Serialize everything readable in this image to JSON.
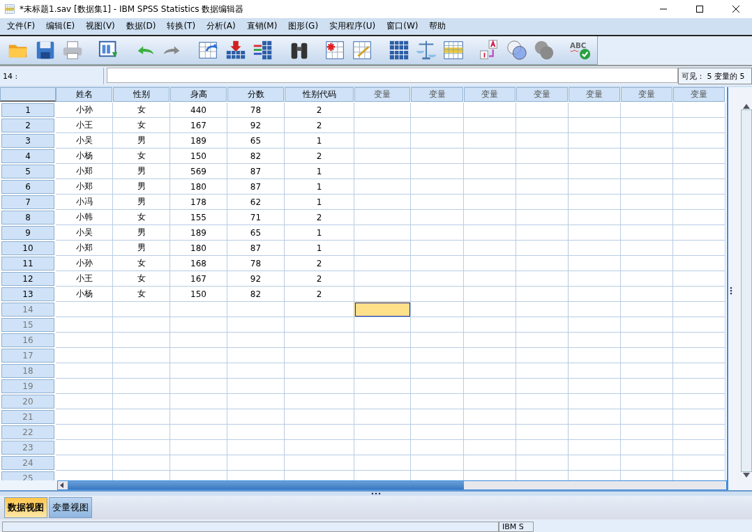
{
  "window": {
    "title": "*未标题1.sav [数据集1] - IBM SPSS Statistics 数据编辑器"
  },
  "menu": [
    "文件(F)",
    "编辑(E)",
    "视图(V)",
    "数据(D)",
    "转换(T)",
    "分析(A)",
    "直销(M)",
    "图形(G)",
    "实用程序(U)",
    "窗口(W)",
    "帮助"
  ],
  "toolbar": {
    "spell_check_text": "ABC"
  },
  "cell_editor": {
    "cell_ref": "14 :",
    "visible": "可见： 5 变量的 5"
  },
  "grid": {
    "columns": [
      {
        "label": "姓名",
        "kind": "defined",
        "selected": false
      },
      {
        "label": "性别",
        "kind": "defined",
        "selected": false
      },
      {
        "label": "身高",
        "kind": "defined",
        "selected": false
      },
      {
        "label": "分数",
        "kind": "defined",
        "selected": false
      },
      {
        "label": "性别代码",
        "kind": "defined",
        "selected": false
      },
      {
        "label": "变量",
        "kind": "empty",
        "selected": true
      },
      {
        "label": "变量",
        "kind": "empty",
        "selected": false
      },
      {
        "label": "变量",
        "kind": "empty",
        "selected": false
      },
      {
        "label": "变量",
        "kind": "empty",
        "selected": false
      },
      {
        "label": "变量",
        "kind": "empty",
        "selected": false
      },
      {
        "label": "变量",
        "kind": "empty",
        "selected": false
      },
      {
        "label": "变量",
        "kind": "empty",
        "selected": false
      }
    ],
    "rows": [
      {
        "number": "1",
        "empty": false,
        "selected": false,
        "cells": [
          "小孙",
          "女",
          "440",
          "78",
          "2"
        ]
      },
      {
        "number": "2",
        "empty": false,
        "selected": false,
        "cells": [
          "小王",
          "女",
          "167",
          "92",
          "2"
        ]
      },
      {
        "number": "3",
        "empty": false,
        "selected": false,
        "cells": [
          "小吴",
          "男",
          "189",
          "65",
          "1"
        ]
      },
      {
        "number": "4",
        "empty": false,
        "selected": false,
        "cells": [
          "小杨",
          "女",
          "150",
          "82",
          "2"
        ]
      },
      {
        "number": "5",
        "empty": false,
        "selected": false,
        "cells": [
          "小郑",
          "男",
          "569",
          "87",
          "1"
        ]
      },
      {
        "number": "6",
        "empty": false,
        "selected": false,
        "cells": [
          "小郑",
          "男",
          "180",
          "87",
          "1"
        ]
      },
      {
        "number": "7",
        "empty": false,
        "selected": false,
        "cells": [
          "小冯",
          "男",
          "178",
          "62",
          "1"
        ]
      },
      {
        "number": "8",
        "empty": false,
        "selected": false,
        "cells": [
          "小韩",
          "女",
          "155",
          "71",
          "2"
        ]
      },
      {
        "number": "9",
        "empty": false,
        "selected": false,
        "cells": [
          "小吴",
          "男",
          "189",
          "65",
          "1"
        ]
      },
      {
        "number": "10",
        "empty": false,
        "selected": false,
        "cells": [
          "小郑",
          "男",
          "180",
          "87",
          "1"
        ]
      },
      {
        "number": "11",
        "empty": false,
        "selected": false,
        "cells": [
          "小孙",
          "女",
          "168",
          "78",
          "2"
        ]
      },
      {
        "number": "12",
        "empty": false,
        "selected": false,
        "cells": [
          "小王",
          "女",
          "167",
          "92",
          "2"
        ]
      },
      {
        "number": "13",
        "empty": false,
        "selected": false,
        "cells": [
          "小杨",
          "女",
          "150",
          "82",
          "2"
        ]
      },
      {
        "number": "14",
        "empty": true,
        "selected": true
      },
      {
        "number": "15",
        "empty": true,
        "selected": false
      },
      {
        "number": "16",
        "empty": true,
        "selected": false
      },
      {
        "number": "17",
        "empty": true,
        "selected": false
      },
      {
        "number": "18",
        "empty": true,
        "selected": false
      },
      {
        "number": "19",
        "empty": true,
        "selected": false
      },
      {
        "number": "20",
        "empty": true,
        "selected": false
      },
      {
        "number": "21",
        "empty": true,
        "selected": false
      },
      {
        "number": "22",
        "empty": true,
        "selected": false
      },
      {
        "number": "23",
        "empty": true,
        "selected": false
      },
      {
        "number": "24",
        "empty": true,
        "selected": false
      },
      {
        "number": "25",
        "empty": true,
        "selected": false
      }
    ]
  },
  "tabs": [
    {
      "label": "数据视图",
      "selected": true
    },
    {
      "label": "变量视图",
      "selected": false
    }
  ],
  "status_bar": {
    "processor": "IBM S"
  }
}
